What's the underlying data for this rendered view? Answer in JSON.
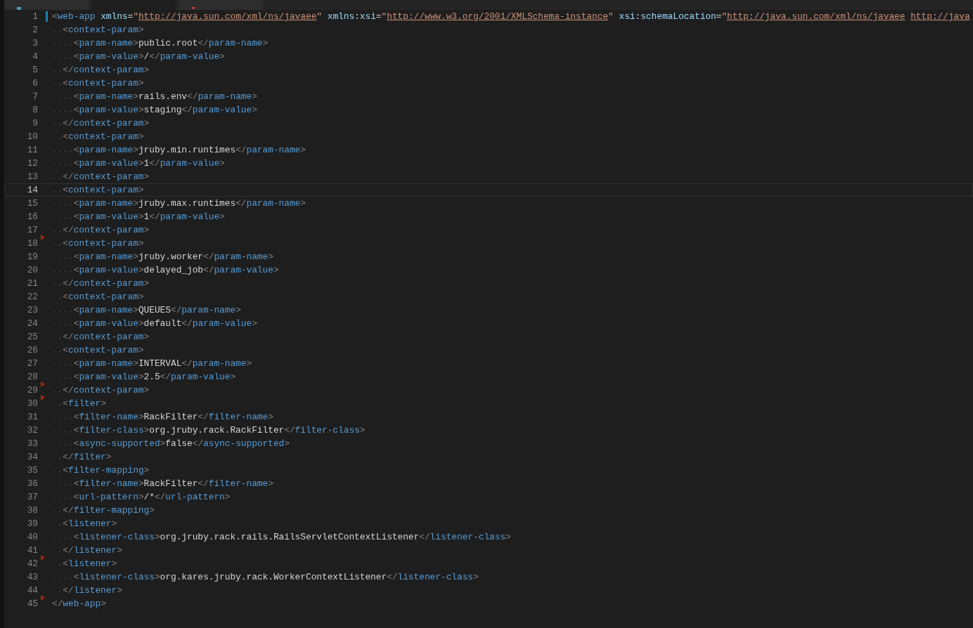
{
  "tabs": [
    {
      "selected": false,
      "kind": "info"
    },
    {
      "selected": true,
      "kind": "plain"
    },
    {
      "selected": false,
      "kind": "gem"
    }
  ],
  "lines": [
    {
      "number": "1",
      "code": "<web-app xmlns=\"http://java.sun.com/xml/ns/javaee\" xmlns:xsi=\"http://www.w3.org/2001/XMLSchema-instance\" xsi:schemaLocation=\"http://java.sun.com/xml/ns/javaee http://java",
      "modified": true,
      "current": false,
      "marker": false
    },
    {
      "number": "2",
      "code": "<context-param>",
      "modified": false,
      "current": false,
      "marker": false
    },
    {
      "number": "3",
      "code": "<param-name>public.root</param-name>",
      "modified": false,
      "current": false,
      "marker": false
    },
    {
      "number": "4",
      "code": "<param-value>/</param-value>",
      "modified": false,
      "current": false,
      "marker": false
    },
    {
      "number": "5",
      "code": "</context-param>",
      "modified": false,
      "current": false,
      "marker": false
    },
    {
      "number": "6",
      "code": "<context-param>",
      "modified": false,
      "current": false,
      "marker": false
    },
    {
      "number": "7",
      "code": "<param-name>rails.env</param-name>",
      "modified": false,
      "current": false,
      "marker": false
    },
    {
      "number": "8",
      "code": "<param-value>staging</param-value>",
      "modified": false,
      "current": false,
      "marker": false
    },
    {
      "number": "9",
      "code": "</context-param>",
      "modified": false,
      "current": false,
      "marker": false
    },
    {
      "number": "10",
      "code": "<context-param>",
      "modified": false,
      "current": false,
      "marker": false
    },
    {
      "number": "11",
      "code": "<param-name>jruby.min.runtimes</param-name>",
      "modified": false,
      "current": false,
      "marker": false
    },
    {
      "number": "12",
      "code": "<param-value>1</param-value>",
      "modified": false,
      "current": false,
      "marker": false
    },
    {
      "number": "13",
      "code": "</context-param>",
      "modified": false,
      "current": false,
      "marker": false
    },
    {
      "number": "14",
      "code": "<context-param>",
      "modified": false,
      "current": true,
      "marker": false
    },
    {
      "number": "15",
      "code": "<param-name>jruby.max.runtimes</param-name>",
      "modified": false,
      "current": false,
      "marker": false
    },
    {
      "number": "16",
      "code": "<param-value>1</param-value>",
      "modified": false,
      "current": false,
      "marker": false
    },
    {
      "number": "17",
      "code": "</context-param>",
      "modified": false,
      "current": false,
      "marker": true
    },
    {
      "number": "18",
      "code": "<context-param>",
      "modified": false,
      "current": false,
      "marker": false
    },
    {
      "number": "19",
      "code": "<param-name>jruby.worker</param-name>",
      "modified": false,
      "current": false,
      "marker": false
    },
    {
      "number": "20",
      "code": "<param-value>delayed_job</param-value>",
      "modified": false,
      "current": false,
      "marker": false
    },
    {
      "number": "21",
      "code": "</context-param>",
      "modified": false,
      "current": false,
      "marker": false
    },
    {
      "number": "22",
      "code": "<context-param>",
      "modified": false,
      "current": false,
      "marker": false
    },
    {
      "number": "23",
      "code": "<param-name>QUEUES</param-name>",
      "modified": false,
      "current": false,
      "marker": false
    },
    {
      "number": "24",
      "code": "<param-value>default</param-value>",
      "modified": false,
      "current": false,
      "marker": false
    },
    {
      "number": "25",
      "code": "</context-param>",
      "modified": false,
      "current": false,
      "marker": false
    },
    {
      "number": "26",
      "code": "<context-param>",
      "modified": false,
      "current": false,
      "marker": false
    },
    {
      "number": "27",
      "code": "<param-name>INTERVAL</param-name>",
      "modified": false,
      "current": false,
      "marker": false
    },
    {
      "number": "28",
      "code": "<param-value>2.5</param-value>",
      "modified": false,
      "current": false,
      "marker": true
    },
    {
      "number": "29",
      "code": "</context-param>",
      "modified": false,
      "current": false,
      "marker": true
    },
    {
      "number": "30",
      "code": "<filter>",
      "modified": false,
      "current": false,
      "marker": false
    },
    {
      "number": "31",
      "code": "<filter-name>RackFilter</filter-name>",
      "modified": false,
      "current": false,
      "marker": false
    },
    {
      "number": "32",
      "code": "<filter-class>org.jruby.rack.RackFilter</filter-class>",
      "modified": false,
      "current": false,
      "marker": false
    },
    {
      "number": "33",
      "code": "<async-supported>false</async-supported>",
      "modified": false,
      "current": false,
      "marker": false
    },
    {
      "number": "34",
      "code": "</filter>",
      "modified": false,
      "current": false,
      "marker": false
    },
    {
      "number": "35",
      "code": "<filter-mapping>",
      "modified": false,
      "current": false,
      "marker": false
    },
    {
      "number": "36",
      "code": "<filter-name>RackFilter</filter-name>",
      "modified": false,
      "current": false,
      "marker": false
    },
    {
      "number": "37",
      "code": "<url-pattern>/*</url-pattern>",
      "modified": false,
      "current": false,
      "marker": false
    },
    {
      "number": "38",
      "code": "</filter-mapping>",
      "modified": false,
      "current": false,
      "marker": false
    },
    {
      "number": "39",
      "code": "<listener>",
      "modified": false,
      "current": false,
      "marker": false
    },
    {
      "number": "40",
      "code": "<listener-class>org.jruby.rack.rails.RailsServletContextListener</listener-class>",
      "modified": false,
      "current": false,
      "marker": false
    },
    {
      "number": "41",
      "code": "</listener>",
      "modified": false,
      "current": false,
      "marker": true
    },
    {
      "number": "42",
      "code": "<listener>",
      "modified": false,
      "current": false,
      "marker": false
    },
    {
      "number": "43",
      "code": "<listener-class>org.kares.jruby.rack.WorkerContextListener</listener-class>",
      "modified": false,
      "current": false,
      "marker": false
    },
    {
      "number": "44",
      "code": "</listener>",
      "modified": false,
      "current": false,
      "marker": true
    },
    {
      "number": "45",
      "code": "</web-app>",
      "modified": false,
      "current": false,
      "marker": false
    }
  ]
}
